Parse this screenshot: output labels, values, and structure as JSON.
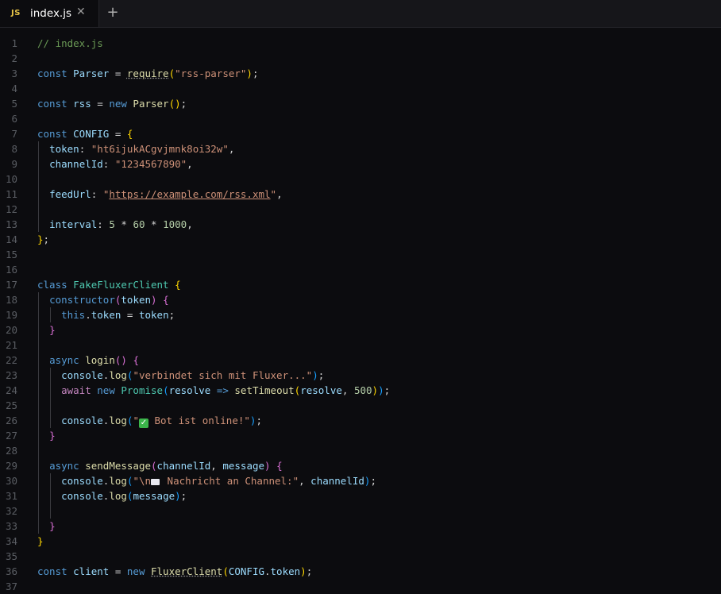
{
  "tab": {
    "badge": "JS",
    "name": "index.js",
    "close": "✕",
    "new": "+"
  },
  "lines": [
    {
      "n": "1",
      "s": [
        [
          "cm",
          "// index.js"
        ]
      ]
    },
    {
      "n": "2",
      "s": []
    },
    {
      "n": "3",
      "s": [
        [
          "kw",
          "const "
        ],
        [
          "var",
          "Parser"
        ],
        [
          "txt",
          " = "
        ],
        [
          "fnd",
          "require"
        ],
        [
          "p1",
          "("
        ],
        [
          "str",
          "\"rss-parser\""
        ],
        [
          "p1",
          ")"
        ],
        [
          "txt",
          ";"
        ]
      ]
    },
    {
      "n": "4",
      "s": []
    },
    {
      "n": "5",
      "s": [
        [
          "kw",
          "const "
        ],
        [
          "var",
          "rss"
        ],
        [
          "txt",
          " = "
        ],
        [
          "kw",
          "new "
        ],
        [
          "fn",
          "Parser"
        ],
        [
          "p1",
          "()"
        ],
        [
          "txt",
          ";"
        ]
      ]
    },
    {
      "n": "6",
      "s": []
    },
    {
      "n": "7",
      "s": [
        [
          "kw",
          "const "
        ],
        [
          "var",
          "CONFIG"
        ],
        [
          "txt",
          " = "
        ],
        [
          "p1",
          "{"
        ]
      ]
    },
    {
      "n": "8",
      "s": [
        [
          "txt",
          "  "
        ],
        [
          "var",
          "token"
        ],
        [
          "txt",
          ": "
        ],
        [
          "str",
          "\"ht6ijukACgvjmnk8oi32w\""
        ],
        [
          "txt",
          ","
        ]
      ]
    },
    {
      "n": "9",
      "s": [
        [
          "txt",
          "  "
        ],
        [
          "var",
          "channelId"
        ],
        [
          "txt",
          ": "
        ],
        [
          "str",
          "\"1234567890\""
        ],
        [
          "txt",
          ","
        ]
      ]
    },
    {
      "n": "10",
      "s": []
    },
    {
      "n": "11",
      "s": [
        [
          "txt",
          "  "
        ],
        [
          "var",
          "feedUrl"
        ],
        [
          "txt",
          ": "
        ],
        [
          "str",
          "\""
        ],
        [
          "url",
          "https://example.com/rss.xml"
        ],
        [
          "str",
          "\""
        ],
        [
          "txt",
          ","
        ]
      ]
    },
    {
      "n": "12",
      "s": []
    },
    {
      "n": "13",
      "s": [
        [
          "txt",
          "  "
        ],
        [
          "var",
          "interval"
        ],
        [
          "txt",
          ": "
        ],
        [
          "num",
          "5"
        ],
        [
          "txt",
          " * "
        ],
        [
          "num",
          "60"
        ],
        [
          "txt",
          " * "
        ],
        [
          "num",
          "1000"
        ],
        [
          "txt",
          ","
        ]
      ]
    },
    {
      "n": "14",
      "s": [
        [
          "p1",
          "}"
        ],
        [
          "txt",
          ";"
        ]
      ]
    },
    {
      "n": "15",
      "s": []
    },
    {
      "n": "16",
      "s": []
    },
    {
      "n": "17",
      "s": [
        [
          "kw",
          "class "
        ],
        [
          "cls",
          "FakeFluxerClient"
        ],
        [
          "txt",
          " "
        ],
        [
          "p1",
          "{"
        ]
      ]
    },
    {
      "n": "18",
      "s": [
        [
          "txt",
          "  "
        ],
        [
          "kw",
          "constructor"
        ],
        [
          "p2",
          "("
        ],
        [
          "var",
          "token"
        ],
        [
          "p2",
          ")"
        ],
        [
          "txt",
          " "
        ],
        [
          "p2",
          "{"
        ]
      ]
    },
    {
      "n": "19",
      "s": [
        [
          "txt",
          "    "
        ],
        [
          "kw",
          "this"
        ],
        [
          "txt",
          "."
        ],
        [
          "var",
          "token"
        ],
        [
          "txt",
          " = "
        ],
        [
          "var",
          "token"
        ],
        [
          "txt",
          ";"
        ]
      ]
    },
    {
      "n": "20",
      "s": [
        [
          "txt",
          "  "
        ],
        [
          "p2",
          "}"
        ]
      ]
    },
    {
      "n": "21",
      "s": []
    },
    {
      "n": "22",
      "s": [
        [
          "txt",
          "  "
        ],
        [
          "kw",
          "async "
        ],
        [
          "fn",
          "login"
        ],
        [
          "p2",
          "()"
        ],
        [
          "txt",
          " "
        ],
        [
          "p2",
          "{"
        ]
      ]
    },
    {
      "n": "23",
      "s": [
        [
          "txt",
          "    "
        ],
        [
          "var",
          "console"
        ],
        [
          "txt",
          "."
        ],
        [
          "fn",
          "log"
        ],
        [
          "p3",
          "("
        ],
        [
          "str",
          "\"verbindet sich mit Fluxer...\""
        ],
        [
          "p3",
          ")"
        ],
        [
          "txt",
          ";"
        ]
      ]
    },
    {
      "n": "24",
      "s": [
        [
          "txt",
          "    "
        ],
        [
          "kw2",
          "await "
        ],
        [
          "kw",
          "new "
        ],
        [
          "cls",
          "Promise"
        ],
        [
          "p3",
          "("
        ],
        [
          "var",
          "resolve"
        ],
        [
          "txt",
          " "
        ],
        [
          "kw",
          "=>"
        ],
        [
          "txt",
          " "
        ],
        [
          "fn",
          "setTimeout"
        ],
        [
          "p1",
          "("
        ],
        [
          "var",
          "resolve"
        ],
        [
          "txt",
          ", "
        ],
        [
          "num",
          "500"
        ],
        [
          "p1",
          ")"
        ],
        [
          "p3",
          ")"
        ],
        [
          "txt",
          ";"
        ]
      ]
    },
    {
      "n": "25",
      "s": []
    },
    {
      "n": "26",
      "s": [
        [
          "txt",
          "    "
        ],
        [
          "var",
          "console"
        ],
        [
          "txt",
          "."
        ],
        [
          "fn",
          "log"
        ],
        [
          "p3",
          "("
        ],
        [
          "str",
          "\""
        ],
        [
          "check",
          "✓"
        ],
        [
          "str",
          " Bot ist online!\""
        ],
        [
          "p3",
          ")"
        ],
        [
          "txt",
          ";"
        ]
      ]
    },
    {
      "n": "27",
      "s": [
        [
          "txt",
          "  "
        ],
        [
          "p2",
          "}"
        ]
      ]
    },
    {
      "n": "28",
      "s": []
    },
    {
      "n": "29",
      "s": [
        [
          "txt",
          "  "
        ],
        [
          "kw",
          "async "
        ],
        [
          "fn",
          "sendMessage"
        ],
        [
          "p2",
          "("
        ],
        [
          "var",
          "channelId"
        ],
        [
          "txt",
          ", "
        ],
        [
          "var",
          "message"
        ],
        [
          "p2",
          ")"
        ],
        [
          "txt",
          " "
        ],
        [
          "p2",
          "{"
        ]
      ]
    },
    {
      "n": "30",
      "s": [
        [
          "txt",
          "    "
        ],
        [
          "var",
          "console"
        ],
        [
          "txt",
          "."
        ],
        [
          "fn",
          "log"
        ],
        [
          "p3",
          "("
        ],
        [
          "str",
          "\"\\n"
        ],
        [
          "box",
          ""
        ],
        [
          "str",
          " Nachricht an Channel:\""
        ],
        [
          "txt",
          ", "
        ],
        [
          "var",
          "channelId"
        ],
        [
          "p3",
          ")"
        ],
        [
          "txt",
          ";"
        ]
      ]
    },
    {
      "n": "31",
      "s": [
        [
          "txt",
          "    "
        ],
        [
          "var",
          "console"
        ],
        [
          "txt",
          "."
        ],
        [
          "fn",
          "log"
        ],
        [
          "p3",
          "("
        ],
        [
          "var",
          "message"
        ],
        [
          "p3",
          ")"
        ],
        [
          "txt",
          ";"
        ]
      ]
    },
    {
      "n": "32",
      "s": []
    },
    {
      "n": "33",
      "s": [
        [
          "txt",
          "  "
        ],
        [
          "p2",
          "}"
        ]
      ]
    },
    {
      "n": "34",
      "s": [
        [
          "p1",
          "}"
        ]
      ]
    },
    {
      "n": "35",
      "s": []
    },
    {
      "n": "36",
      "s": [
        [
          "kw",
          "const "
        ],
        [
          "var",
          "client"
        ],
        [
          "txt",
          " = "
        ],
        [
          "kw",
          "new "
        ],
        [
          "fnd",
          "FluxerClient"
        ],
        [
          "p1",
          "("
        ],
        [
          "var",
          "CONFIG"
        ],
        [
          "txt",
          "."
        ],
        [
          "var",
          "token"
        ],
        [
          "p1",
          ")"
        ],
        [
          "txt",
          ";"
        ]
      ]
    },
    {
      "n": "37",
      "s": []
    }
  ],
  "colors": {
    "background": "#0c0c0f",
    "keyword": "#569cd6",
    "string": "#ce9178",
    "variable": "#9cdcfe",
    "function": "#dcdcaa",
    "class": "#4ec9b0",
    "comment": "#6a9955"
  },
  "icons": {
    "file_type": "js-file-icon",
    "close": "close-icon",
    "new_tab": "plus-icon"
  }
}
